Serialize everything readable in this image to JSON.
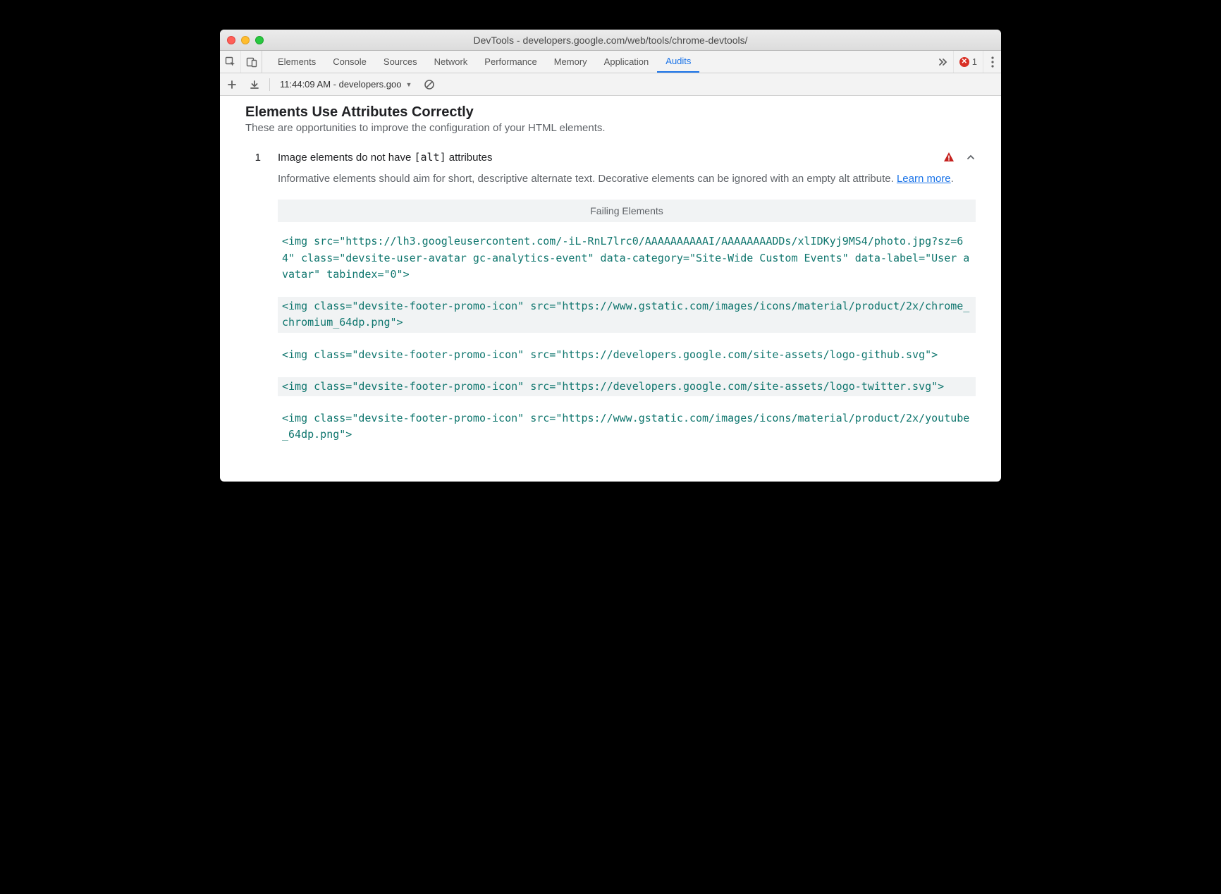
{
  "window": {
    "title": "DevTools - developers.google.com/web/tools/chrome-devtools/"
  },
  "tabs": {
    "items": [
      "Elements",
      "Console",
      "Sources",
      "Network",
      "Performance",
      "Memory",
      "Application",
      "Audits"
    ],
    "active": "Audits",
    "error_count": "1"
  },
  "subbar": {
    "dropdown": "11:44:09 AM - developers.goo"
  },
  "section": {
    "title": "Elements Use Attributes Correctly",
    "subtitle": "These are opportunities to improve the configuration of your HTML elements."
  },
  "audit": {
    "number": "1",
    "title_pre": "Image elements do not have ",
    "title_code": "[alt]",
    "title_post": " attributes",
    "desc_pre": "Informative elements should aim for short, descriptive alternate text. Decorative elements can be ignored with an empty alt attribute. ",
    "learn_more": "Learn more",
    "desc_post": ".",
    "failing_header": "Failing Elements",
    "items": [
      "<img src=\"https://lh3.googleusercontent.com/-iL-RnL7lrc0/AAAAAAAAAAI/AAAAAAAADDs/xlIDKyj9MS4/photo.jpg?sz=64\" class=\"devsite-user-avatar gc-analytics-event\" data-category=\"Site-Wide Custom Events\" data-label=\"User avatar\" tabindex=\"0\">",
      "<img class=\"devsite-footer-promo-icon\" src=\"https://www.gstatic.com/images/icons/material/product/2x/chrome_chromium_64dp.png\">",
      "<img class=\"devsite-footer-promo-icon\" src=\"https://developers.google.com/site-assets/logo-github.svg\">",
      "<img class=\"devsite-footer-promo-icon\" src=\"https://developers.google.com/site-assets/logo-twitter.svg\">",
      "<img class=\"devsite-footer-promo-icon\" src=\"https://www.gstatic.com/images/icons/material/product/2x/youtube_64dp.png\">"
    ]
  }
}
